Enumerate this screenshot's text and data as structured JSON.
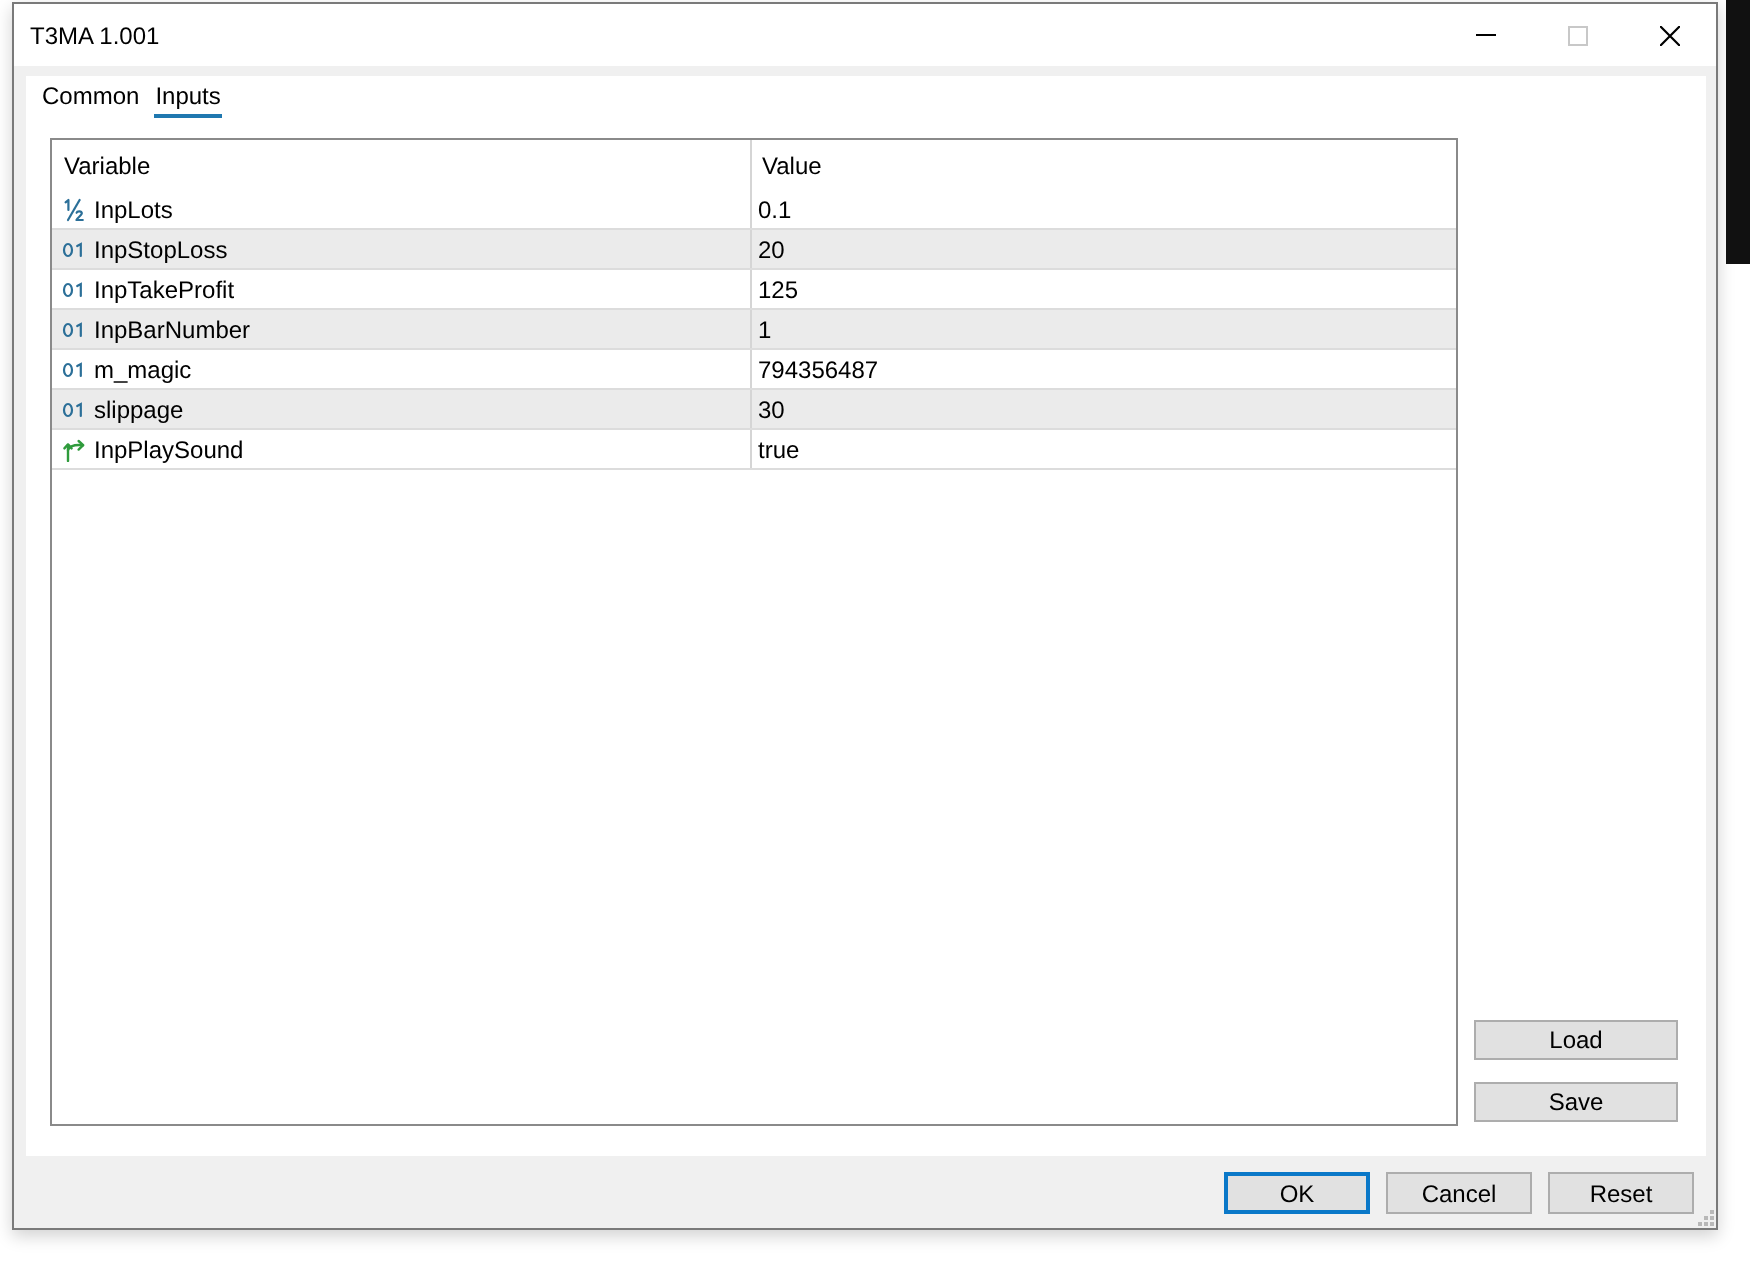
{
  "window": {
    "title": "T3MA 1.001",
    "controls": [
      {
        "kind": "minimize",
        "disabled": false
      },
      {
        "kind": "maximize",
        "disabled": true
      },
      {
        "kind": "close",
        "disabled": false
      }
    ]
  },
  "tabs": [
    {
      "label": "Common",
      "selected": false
    },
    {
      "label": "Inputs",
      "selected": true
    }
  ],
  "table": {
    "columns": [
      "Variable",
      "Value"
    ],
    "rows": [
      {
        "kind": "double",
        "variable": "InpLots",
        "value": "0.1"
      },
      {
        "kind": "int",
        "variable": "InpStopLoss",
        "value": "20"
      },
      {
        "kind": "int",
        "variable": "InpTakeProfit",
        "value": "125"
      },
      {
        "kind": "int",
        "variable": "InpBarNumber",
        "value": "1"
      },
      {
        "kind": "int",
        "variable": "m_magic",
        "value": "794356487"
      },
      {
        "kind": "int",
        "variable": "slippage",
        "value": "30"
      },
      {
        "kind": "bool",
        "variable": "InpPlaySound",
        "value": "true"
      }
    ]
  },
  "side_buttons": [
    "Load",
    "Save"
  ],
  "footer_buttons": [
    {
      "label": "OK",
      "default": true
    },
    {
      "label": "Cancel",
      "default": false
    },
    {
      "label": "Reset",
      "default": false
    }
  ]
}
